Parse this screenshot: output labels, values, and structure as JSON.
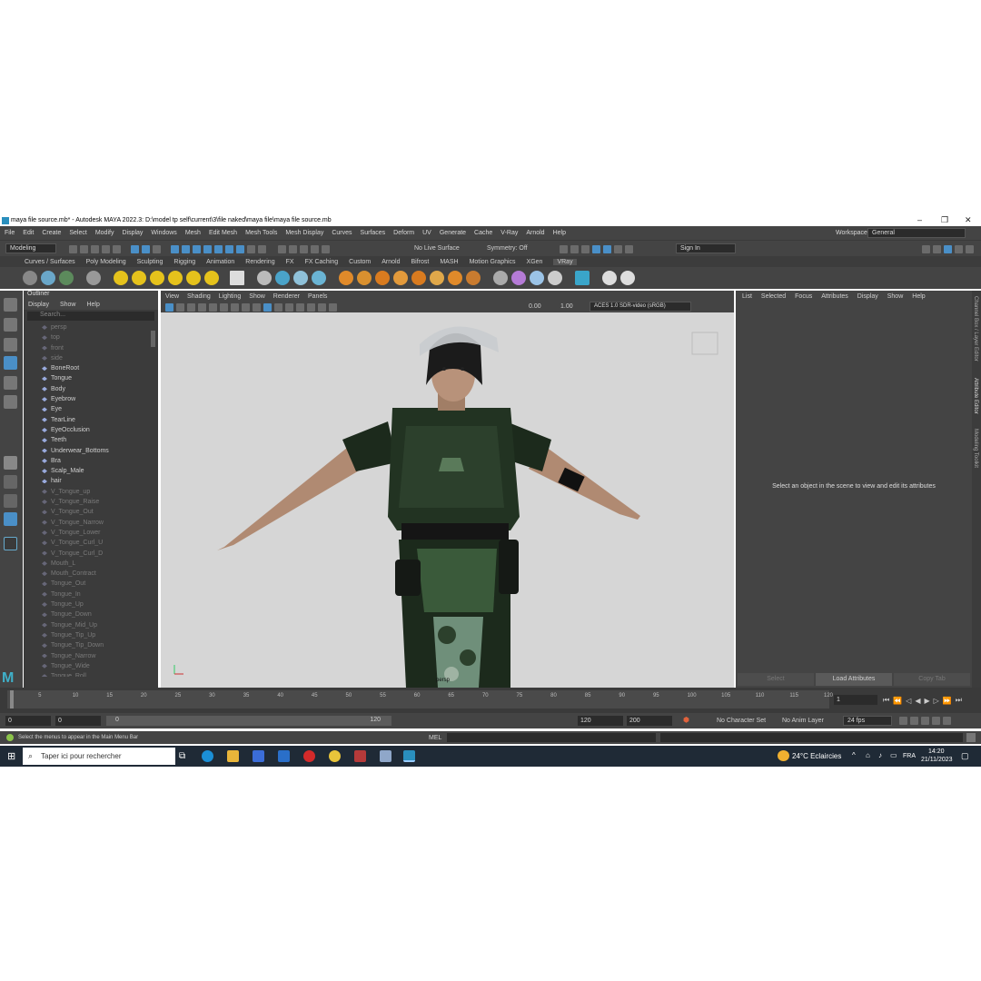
{
  "window": {
    "title": "maya file source.mb* - Autodesk MAYA 2022.3: D:\\model tp self\\current\\3\\file naked\\maya file\\maya file source.mb"
  },
  "menubar": {
    "items": [
      "File",
      "Edit",
      "Create",
      "Select",
      "Modify",
      "Display",
      "Windows",
      "Mesh",
      "Edit Mesh",
      "Mesh Tools",
      "Mesh Display",
      "Curves",
      "Surfaces",
      "Deform",
      "UV",
      "Generate",
      "Cache",
      "V-Ray",
      "Arnold",
      "Help"
    ],
    "workspace_label": "Workspace:",
    "workspace_value": "General"
  },
  "statusline": {
    "mode": "Modeling",
    "live_surface": "No Live Surface",
    "symmetry": "Symmetry: Off",
    "sign_in": "Sign In"
  },
  "shelf": {
    "tabs": [
      "Curves / Surfaces",
      "Poly Modeling",
      "Sculpting",
      "Rigging",
      "Animation",
      "Rendering",
      "FX",
      "FX Caching",
      "Custom",
      "Arnold",
      "Bifrost",
      "MASH",
      "Motion Graphics",
      "XGen",
      "VRay"
    ],
    "selected_tab": "VRay"
  },
  "outliner": {
    "title": "Outliner",
    "menu": [
      "Display",
      "Show",
      "Help"
    ],
    "search_placeholder": "Search...",
    "items": [
      {
        "label": "persp",
        "dim": true
      },
      {
        "label": "top",
        "dim": true
      },
      {
        "label": "front",
        "dim": true
      },
      {
        "label": "side",
        "dim": true
      },
      {
        "label": "BoneRoot",
        "dim": false
      },
      {
        "label": "Tongue",
        "dim": false
      },
      {
        "label": "Body",
        "dim": false
      },
      {
        "label": "Eyebrow",
        "dim": false
      },
      {
        "label": "Eye",
        "dim": false
      },
      {
        "label": "TearLine",
        "dim": false
      },
      {
        "label": "EyeOcclusion",
        "dim": false
      },
      {
        "label": "Teeth",
        "dim": false
      },
      {
        "label": "Underwear_Bottoms",
        "dim": false
      },
      {
        "label": "Bra",
        "dim": false
      },
      {
        "label": "Scalp_Male",
        "dim": false
      },
      {
        "label": "hair",
        "dim": false
      },
      {
        "label": "V_Tongue_up",
        "dim": true
      },
      {
        "label": "V_Tongue_Raise",
        "dim": true
      },
      {
        "label": "V_Tongue_Out",
        "dim": true
      },
      {
        "label": "V_Tongue_Narrow",
        "dim": true
      },
      {
        "label": "V_Tongue_Lower",
        "dim": true
      },
      {
        "label": "V_Tongue_Curl_U",
        "dim": true
      },
      {
        "label": "V_Tongue_Curl_D",
        "dim": true
      },
      {
        "label": "Mouth_L",
        "dim": true
      },
      {
        "label": "Mouth_Contract",
        "dim": true
      },
      {
        "label": "Tongue_Out",
        "dim": true
      },
      {
        "label": "Tongue_In",
        "dim": true
      },
      {
        "label": "Tongue_Up",
        "dim": true
      },
      {
        "label": "Tongue_Down",
        "dim": true
      },
      {
        "label": "Tongue_Mid_Up",
        "dim": true
      },
      {
        "label": "Tongue_Tip_Up",
        "dim": true
      },
      {
        "label": "Tongue_Tip_Down",
        "dim": true
      },
      {
        "label": "Tongue_Narrow",
        "dim": true
      },
      {
        "label": "Tongue_Wide",
        "dim": true
      },
      {
        "label": "Tongue_Roll",
        "dim": true
      }
    ]
  },
  "viewport": {
    "menu": [
      "View",
      "Shading",
      "Lighting",
      "Show",
      "Renderer",
      "Panels"
    ],
    "exposure": "0.00",
    "gamma": "1.00",
    "color_space": "ACES 1.0 SDR-video (sRGB)",
    "camera_label": "persp"
  },
  "attribute_editor": {
    "menu": [
      "List",
      "Selected",
      "Focus",
      "Attributes",
      "Display",
      "Show",
      "Help"
    ],
    "message": "Select an object in the scene to view and edit its attributes",
    "buttons": [
      "Select",
      "Load Attributes",
      "Copy Tab"
    ]
  },
  "side_tabs": [
    "Channel Box / Layer Editor",
    "Attribute Editor",
    "Modeling Toolkit"
  ],
  "timeline": {
    "ticks": [
      "1",
      "5",
      "10",
      "15",
      "20",
      "25",
      "30",
      "35",
      "40",
      "45",
      "50",
      "55",
      "60",
      "65",
      "70",
      "75",
      "80",
      "85",
      "90",
      "95",
      "100",
      "105",
      "110",
      "115",
      "120"
    ],
    "current_frame": "1"
  },
  "range": {
    "start": "0",
    "playback_start": "0",
    "slider_start": "0",
    "slider_end": "120",
    "playback_end": "120",
    "end": "200",
    "character_set": "No Character Set",
    "anim_layer": "No Anim Layer",
    "fps": "24 fps"
  },
  "helpline": {
    "text": "Select the menus to appear in the Main Menu Bar",
    "mel_label": "MEL"
  },
  "taskbar": {
    "search_placeholder": "Taper ici pour rechercher",
    "weather": "24°C  Eclaircies",
    "language": "FRA",
    "time": "14:20",
    "date": "21/11/2023"
  },
  "colors": {
    "panel": "#444444",
    "accent": "#4a8fc7",
    "viewport_bg": "#d6d6d6"
  }
}
